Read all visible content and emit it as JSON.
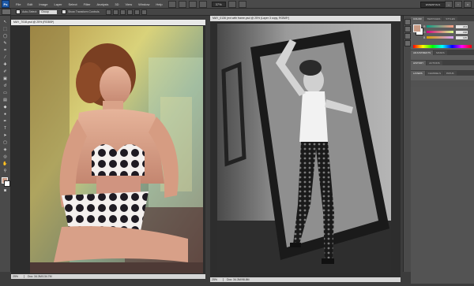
{
  "menubar": {
    "logo": "Ps",
    "items": [
      "File",
      "Edit",
      "Image",
      "Layer",
      "Select",
      "Filter",
      "Analysis",
      "3D",
      "View",
      "Window",
      "Help"
    ],
    "zoom": "37%",
    "workspace": "ESSENTIALS"
  },
  "options": {
    "auto_select_label": "Auto-Select:",
    "auto_select_value": "Group",
    "transform_label": "Show Transform Controls"
  },
  "documents": [
    {
      "tab": "MAY_7018.psd @ 25% (RGB/8*)",
      "zoom": "25%",
      "status": "Doc: 34.3M/134.7M"
    },
    {
      "tab": "MAY_0136 (ext with frame.psd @ 25% (Layer 3 copy, RGB/8*)",
      "zoom": "25%",
      "status": "Doc: 34.3M/98.8M"
    }
  ],
  "color_panel": {
    "tabs": [
      "COLOR",
      "SWATCHES",
      "STYLES"
    ],
    "r": "213",
    "g": "158",
    "b": "135",
    "foreground": "#c89a84",
    "background": "#ffffff"
  },
  "adjust_panel": {
    "tabs": [
      "ADJUSTMENTS",
      "MASKS"
    ]
  },
  "history_panel": {
    "tabs": [
      "HISTORY",
      "ACTIONS"
    ]
  },
  "layers_panel": {
    "tabs": [
      "LAYERS",
      "CHANNELS",
      "PATHS"
    ]
  }
}
